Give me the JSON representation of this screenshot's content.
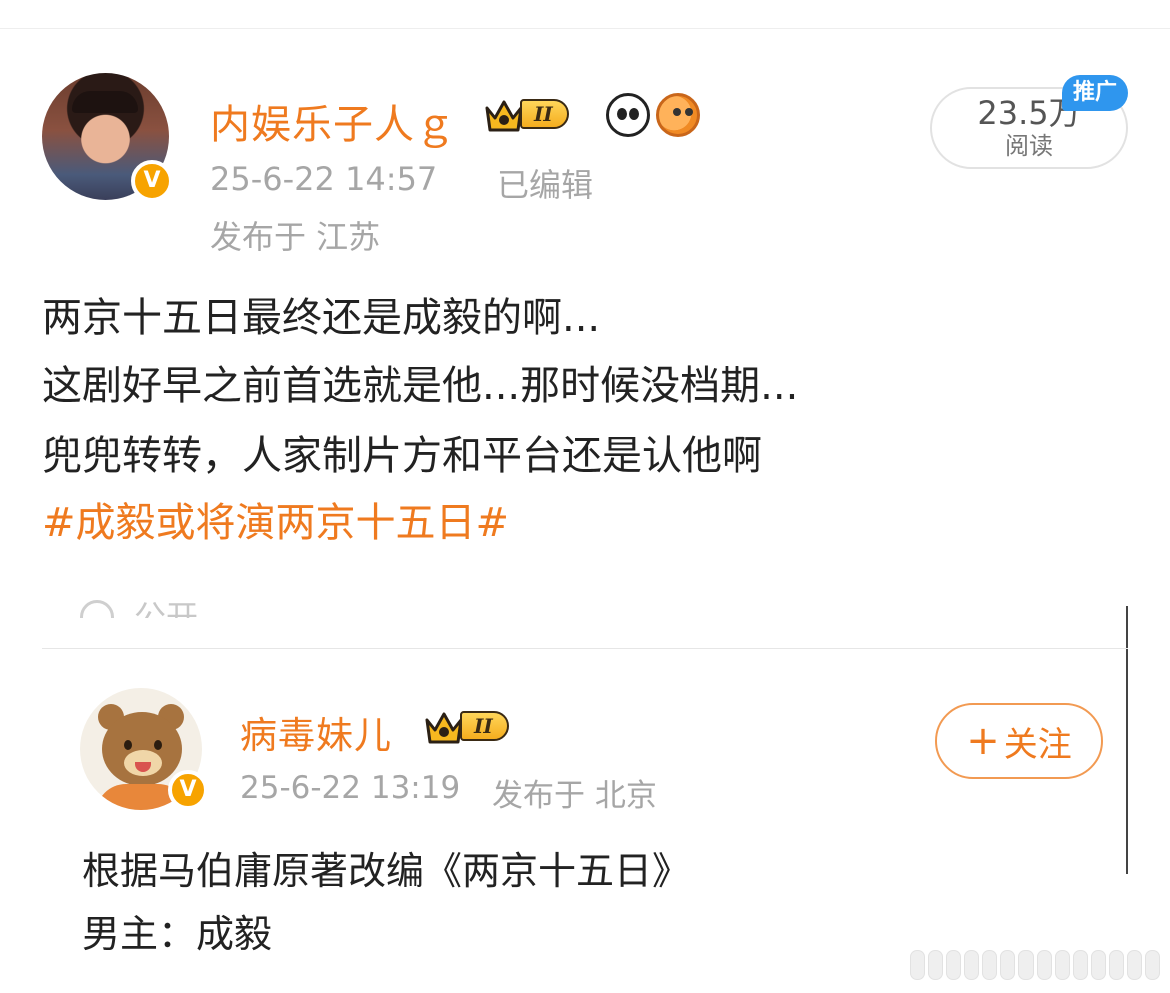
{
  "post": {
    "author": "内娱乐子人ｇ",
    "level_badge": "II",
    "time": "25-6-22 14:57",
    "edited": "已编辑",
    "location": "发布于 江苏",
    "reads": "23.5万",
    "reads_label": "阅读",
    "ad_tag": "推广",
    "lines": [
      "两京十五日最终还是成毅的啊...",
      "这剧好早之前首选就是他...那时候没档期...",
      "兜兜转转，人家制片方和平台还是认他啊"
    ],
    "hashtag": "#成毅或将演两京十五日#",
    "visibility": "公开"
  },
  "quoted": {
    "author": "病毒妹儿",
    "level_badge": "II",
    "time": "25-6-22 13:19",
    "location": "发布于 北京",
    "follow_label": "关注",
    "follow_plus": "+",
    "lines": [
      "根据马伯庸原著改编《两京十五日》",
      "男主：成毅"
    ]
  },
  "verified_glyph": "V",
  "colors": {
    "accent": "#ef7a1f",
    "meta_gray": "#a6a6a6",
    "ad_blue": "#2f96ee",
    "verified_gold": "#f7a300"
  }
}
